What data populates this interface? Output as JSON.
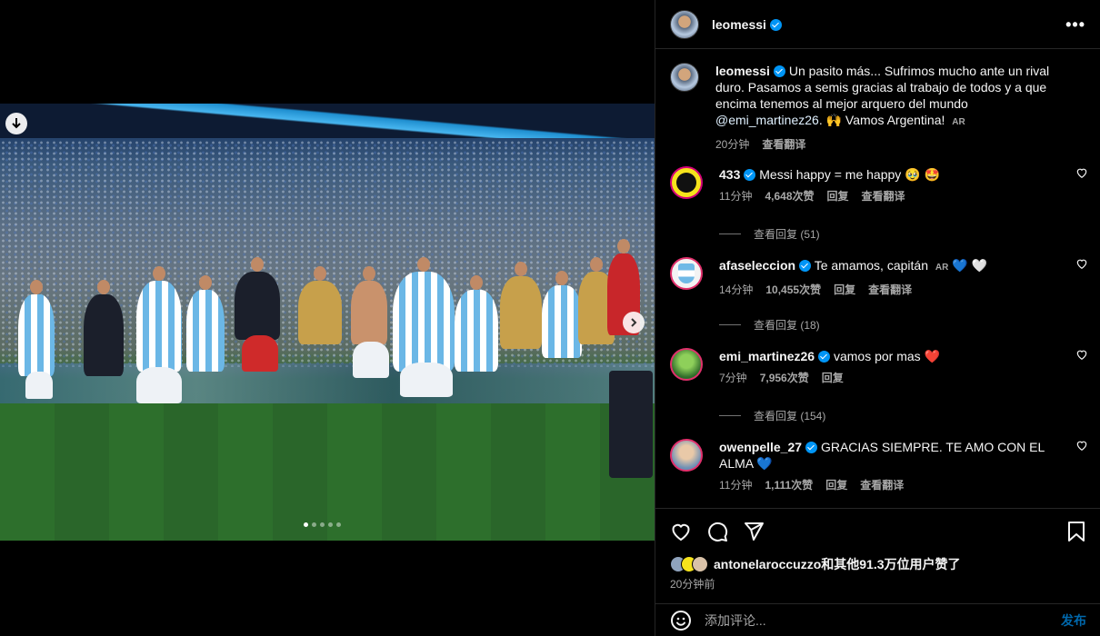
{
  "post": {
    "author": "leomessi",
    "caption": {
      "text_before": "Un pasito más... Sufrimos mucho ante un rival duro. Pasamos a semis gracias al trabajo de todos y a que encima tenemos al mejor arquero del mundo ",
      "mention": "@emi_martinez26",
      "text_after": ". 🙌 Vamos Argentina! ",
      "badge": "AR",
      "time": "20分钟",
      "translate": "查看翻译"
    },
    "carousel": {
      "total": 5,
      "active": 1
    }
  },
  "comments": [
    {
      "user": "433",
      "text": "Messi happy = me happy 🥹 🤩",
      "time": "11分钟",
      "likes": "4,648次赞",
      "reply": "回复",
      "translate": "查看翻译",
      "view_replies": "查看回复 (51)"
    },
    {
      "user": "afaseleccion",
      "text": "Te amamos, capitán ",
      "badge": "AR",
      "text_after": " 💙 🤍",
      "time": "14分钟",
      "likes": "10,455次赞",
      "reply": "回复",
      "translate": "查看翻译",
      "view_replies": "查看回复 (18)"
    },
    {
      "user": "emi_martinez26",
      "text": "vamos por mas ❤️",
      "time": "7分钟",
      "likes": "7,956次赞",
      "reply": "回复",
      "view_replies": "查看回复 (154)"
    },
    {
      "user": "owenpelle_27",
      "text": "GRACIAS SIEMPRE. TE AMO CON EL ALMA 💙",
      "time": "11分钟",
      "likes": "1,111次赞",
      "reply": "回复",
      "translate": "查看翻译"
    }
  ],
  "likes_line": {
    "first_user": "antonelaroccuzzo",
    "rest": "和其他91.3万位用户赞了"
  },
  "posted_ago": "20分钟前",
  "comment_input": {
    "placeholder": "添加评论...",
    "post_label": "发布"
  }
}
